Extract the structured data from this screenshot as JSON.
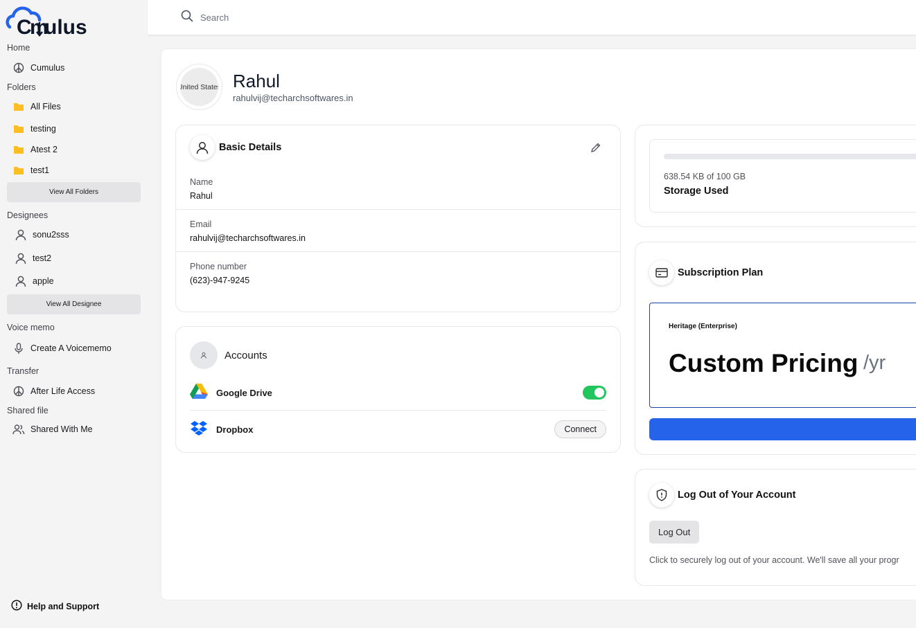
{
  "app": {
    "name": "Cumulus"
  },
  "search": {
    "placeholder": "Search"
  },
  "sidebar": {
    "home_heading": "Home",
    "home_items": [
      {
        "label": "Cumulus",
        "icon": "peace-icon"
      }
    ],
    "folders_heading": "Folders",
    "folders": [
      {
        "label": "All Files",
        "icon": "folder-icon"
      },
      {
        "label": "testing",
        "icon": "folder-icon"
      },
      {
        "label": "Atest 2",
        "icon": "folder-icon"
      },
      {
        "label": "test1",
        "icon": "folder-icon"
      }
    ],
    "view_all_folders": "View All Folders",
    "designees_heading": "Designees",
    "designees": [
      {
        "label": "sonu2sss",
        "icon": "user-icon"
      },
      {
        "label": "test2",
        "icon": "user-icon"
      },
      {
        "label": "apple",
        "icon": "user-icon"
      }
    ],
    "view_all_designee": "View All Designee",
    "voice_heading": "Voice memo",
    "voice_item": "Create A Voicememo",
    "transfer_heading": "Transfer",
    "transfer_item": "After Life Access",
    "shared_heading": "Shared file",
    "shared_item": "Shared With Me",
    "help": "Help and Support"
  },
  "profile": {
    "avatar_text": "United States",
    "name": "Rahul",
    "email": "rahulvij@techarchsoftwares.in"
  },
  "basic_details": {
    "title": "Basic Details",
    "fields": [
      {
        "label": "Name",
        "value": "Rahul"
      },
      {
        "label": "Email",
        "value": "rahulvij@techarchsoftwares.in"
      },
      {
        "label": "Phone number",
        "value": "(623)-947-9245"
      }
    ]
  },
  "accounts": {
    "title": "Accounts",
    "google_drive": {
      "label": "Google Drive",
      "connected": true
    },
    "dropbox": {
      "label": "Dropbox",
      "button": "Connect"
    }
  },
  "storage": {
    "text": "638.54 KB of 100 GB",
    "label": "Storage Used",
    "fraction_used": 0.0
  },
  "subscription": {
    "title": "Subscription Plan",
    "tier": "Heritage (Enterprise)",
    "price": "Custom Pricing",
    "period": "/yr"
  },
  "logout": {
    "title": "Log Out of Your Account",
    "button": "Log Out",
    "note": "Click to securely log out of your account. We'll save all your progr"
  },
  "colors": {
    "accent": "#2563eb",
    "toggle_on": "#22c55e",
    "sidebar_bg": "#f4f4f5"
  }
}
